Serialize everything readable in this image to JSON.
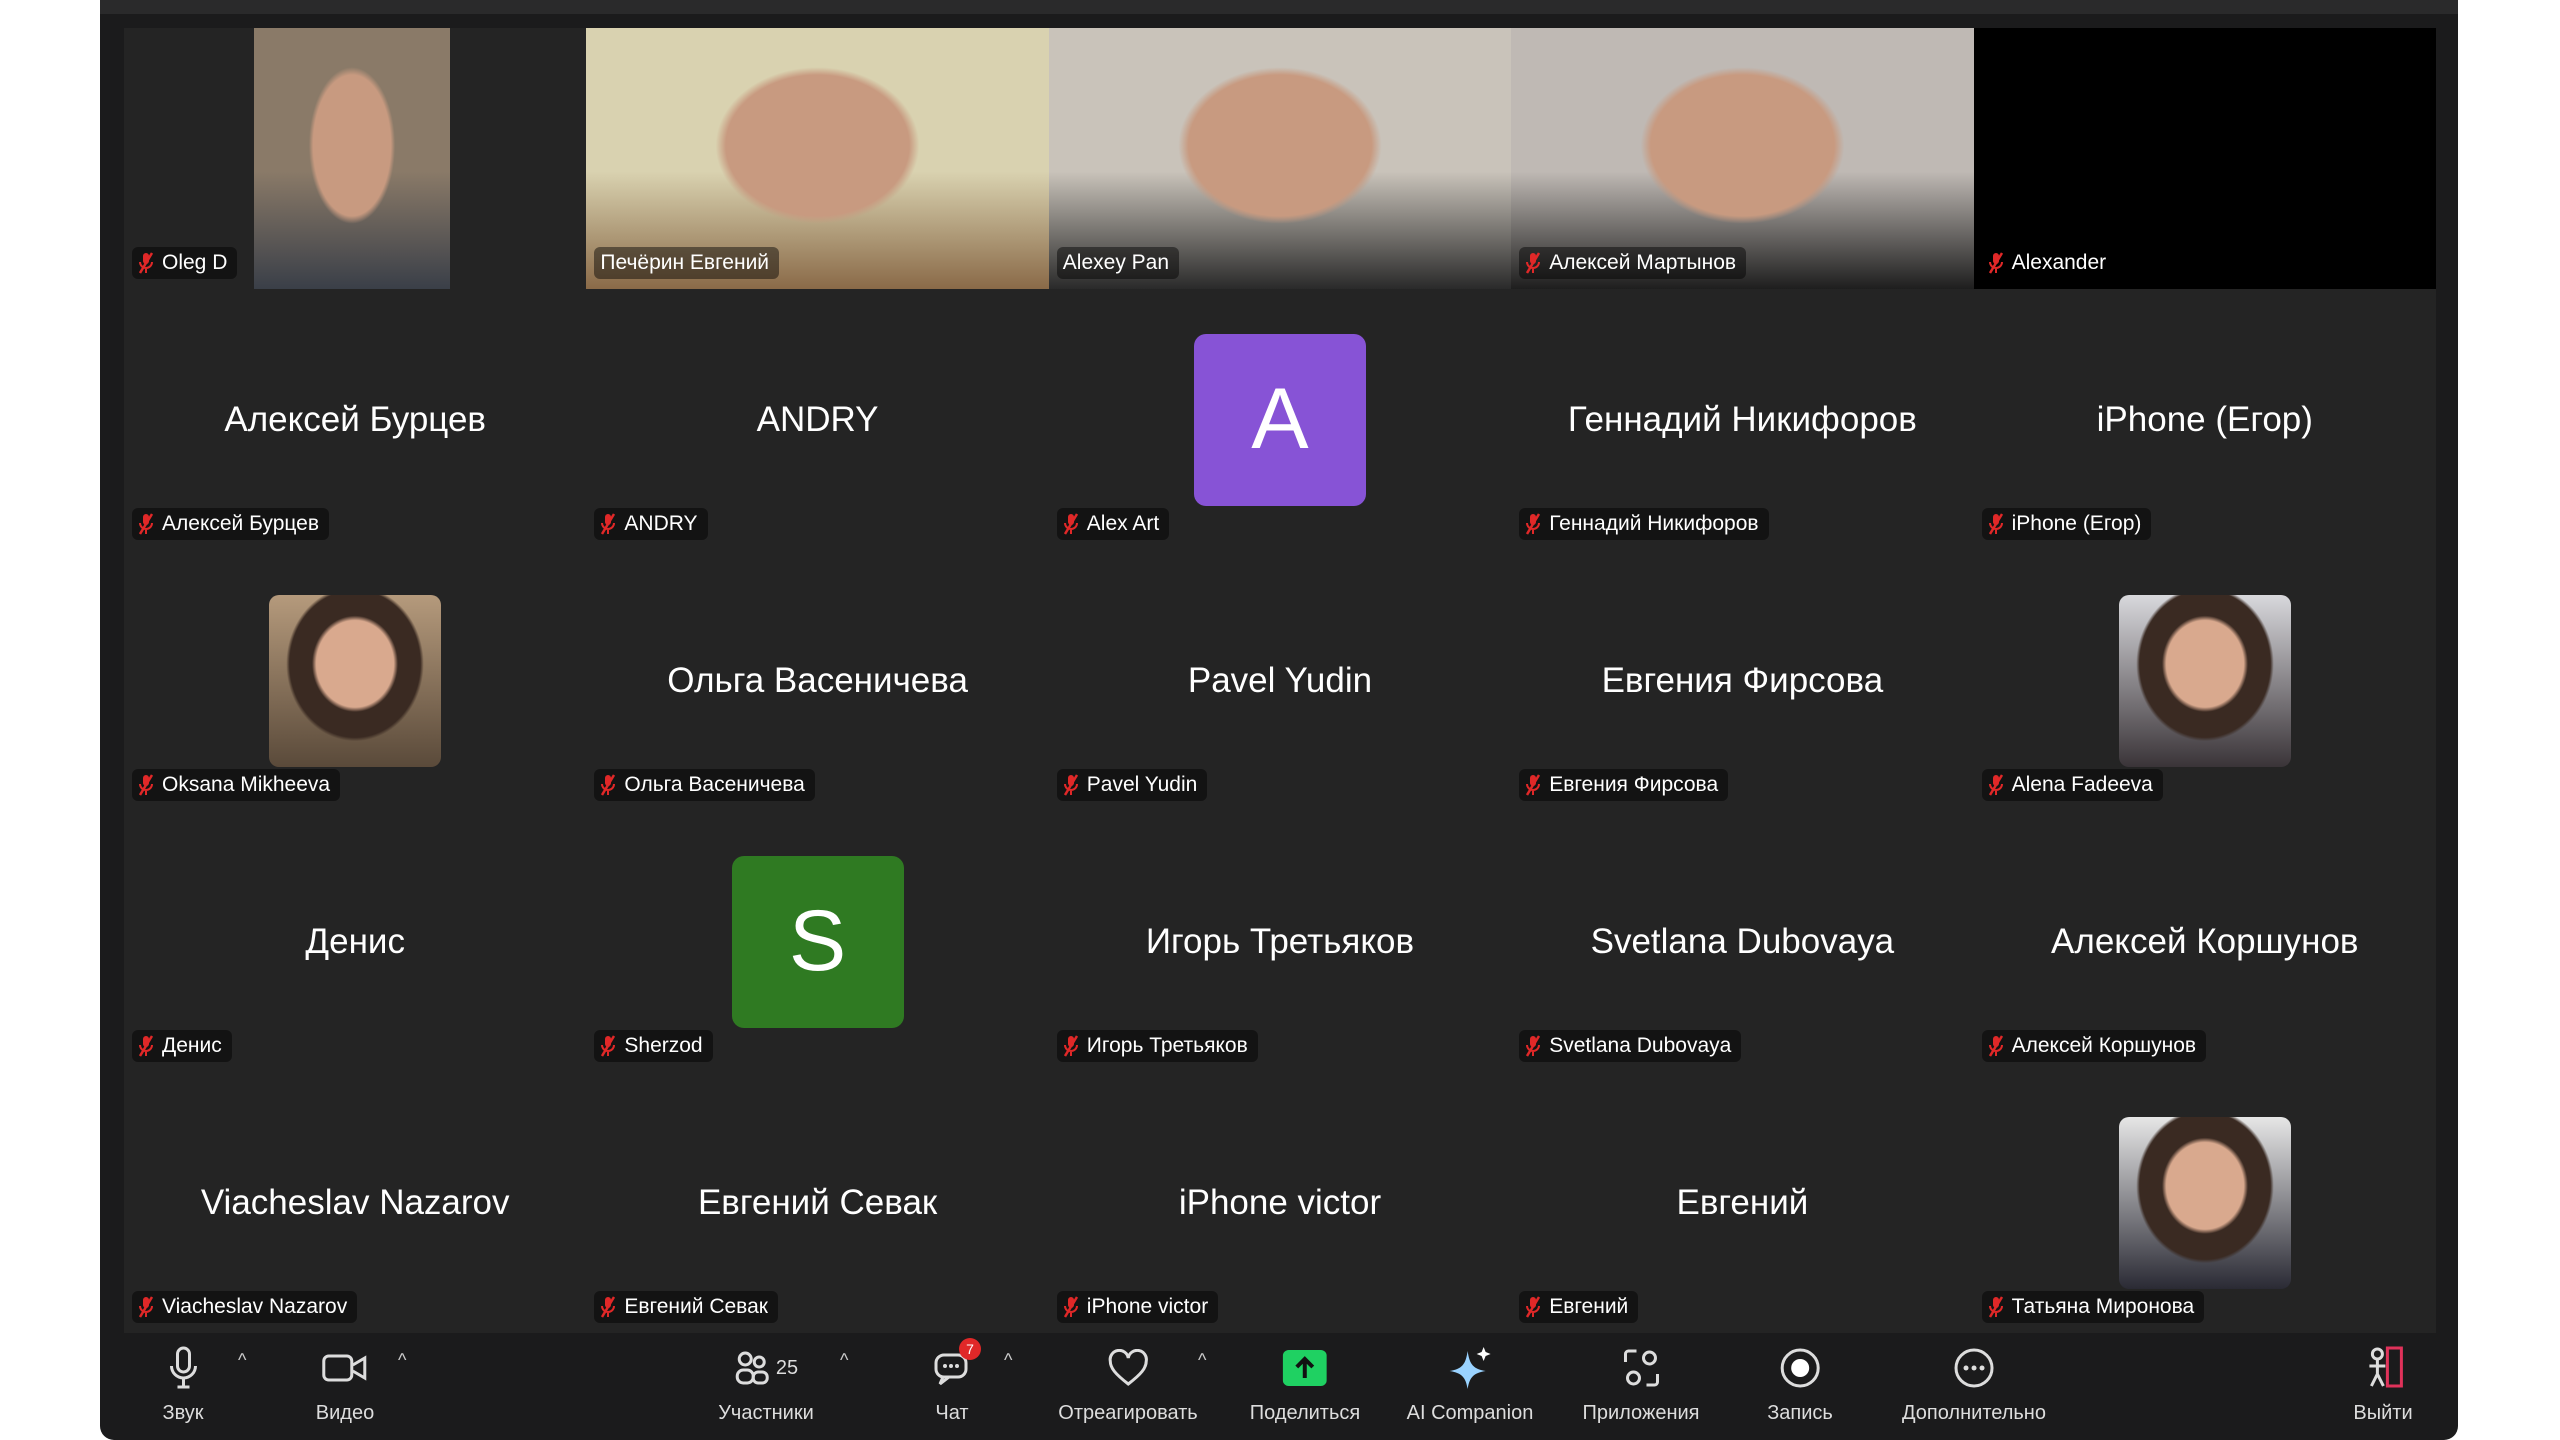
{
  "colors": {
    "active_speaker": "#23c552",
    "muted": "#e02828",
    "share": "#1fd162",
    "tile_bg": "#242424",
    "toolbar_bg": "#1b1b1c"
  },
  "participants": [
    {
      "name": "Oleg D",
      "type": "video",
      "style": "narrow",
      "tone": [
        "#8a7a68",
        "#3a3f48"
      ]
    },
    {
      "name": "Печёрин Евгений",
      "type": "video",
      "style": "full",
      "tone": [
        "#d9d2b0",
        "#8a6a48"
      ],
      "muted": false
    },
    {
      "name": "Alexey Pan",
      "type": "video",
      "style": "full",
      "tone": [
        "#c9c3ba",
        "#2a2a2a"
      ],
      "muted": false,
      "active": true
    },
    {
      "name": "Алексей Мартынов",
      "type": "video",
      "style": "full",
      "tone": [
        "#bfb9b4",
        "#1e1e1e"
      ]
    },
    {
      "name": "Alexander",
      "type": "black"
    },
    {
      "name": "Алексей Бурцев",
      "type": "name"
    },
    {
      "name": "ANDRY",
      "type": "name"
    },
    {
      "name": "Alex Art",
      "type": "avatar",
      "letter": "A",
      "color": "#8753d6"
    },
    {
      "name": "Геннадий Никифоров",
      "type": "name"
    },
    {
      "name": "iPhone (Егор)",
      "type": "name"
    },
    {
      "name": "Oksana Mikheeva",
      "type": "photo",
      "tone": [
        "#b59a7c",
        "#5a4a3a"
      ]
    },
    {
      "name": "Ольга Васеничева",
      "type": "name"
    },
    {
      "name": "Pavel Yudin",
      "type": "name"
    },
    {
      "name": "Евгения Фирсова",
      "type": "name"
    },
    {
      "name": "Alena Fadeeva",
      "type": "photo",
      "tone": [
        "#d8d8dc",
        "#3a3438"
      ]
    },
    {
      "name": "Денис",
      "type": "name"
    },
    {
      "name": "Sherzod",
      "type": "avatar",
      "letter": "S",
      "color": "#2f7a22"
    },
    {
      "name": "Игорь Третьяков",
      "type": "name"
    },
    {
      "name": "Svetlana Dubovaya",
      "type": "name"
    },
    {
      "name": "Алексей Коршунов",
      "type": "name"
    },
    {
      "name": "Viacheslav Nazarov",
      "type": "name"
    },
    {
      "name": "Евгений Севак",
      "type": "name"
    },
    {
      "name": "iPhone victor",
      "type": "name"
    },
    {
      "name": "Евгений",
      "type": "name"
    },
    {
      "name": "Татьяна Миронова",
      "type": "photo",
      "tone": [
        "#e6e6e6",
        "#2a2a34"
      ]
    }
  ],
  "toolbar": {
    "audio": {
      "label": "Звук",
      "icon": "microphone-icon"
    },
    "video": {
      "label": "Видео",
      "icon": "video-camera-icon"
    },
    "participants": {
      "label": "Участники",
      "count": "25",
      "icon": "participants-icon"
    },
    "chat": {
      "label": "Чат",
      "badge": "7",
      "icon": "chat-icon"
    },
    "react": {
      "label": "Отреагировать",
      "icon": "heart-icon"
    },
    "share": {
      "label": "Поделиться",
      "icon": "share-screen-icon"
    },
    "ai": {
      "label": "AI Companion",
      "icon": "sparkle-icon"
    },
    "apps": {
      "label": "Приложения",
      "icon": "apps-icon"
    },
    "record": {
      "label": "Запись",
      "icon": "record-icon"
    },
    "more": {
      "label": "Дополнительно",
      "icon": "more-icon"
    },
    "leave": {
      "label": "Выйти",
      "icon": "leave-icon"
    }
  }
}
